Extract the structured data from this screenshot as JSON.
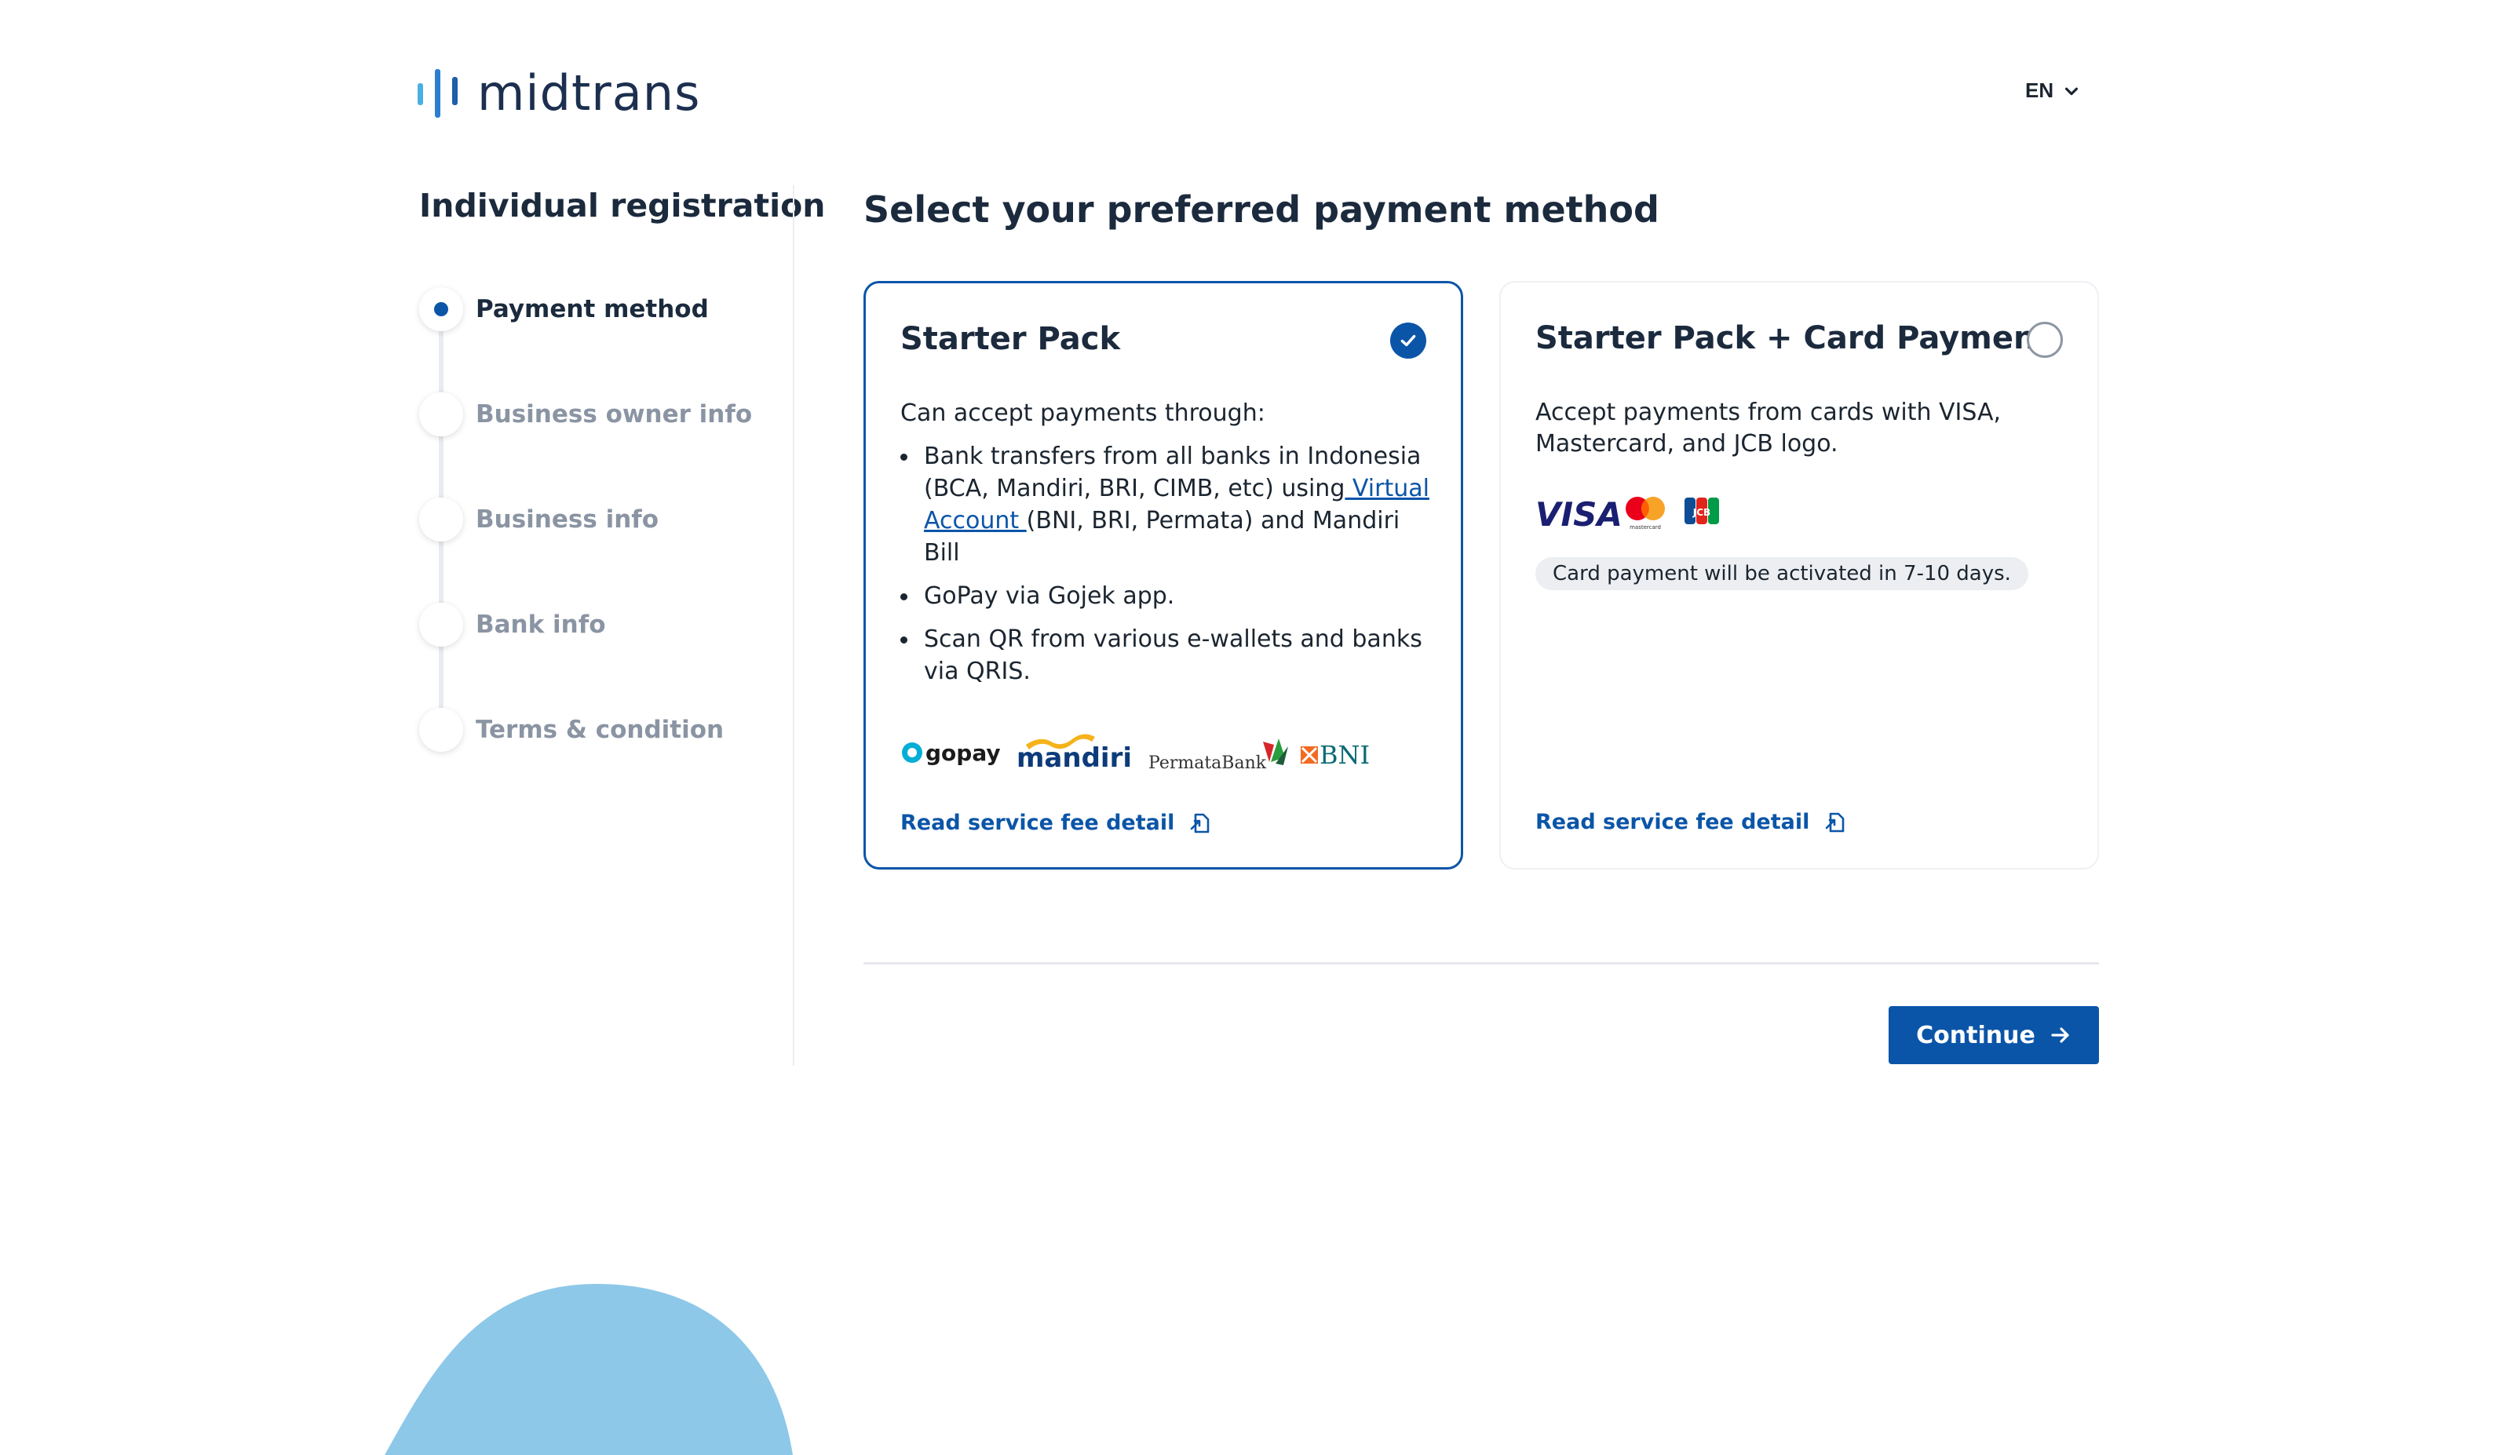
{
  "header": {
    "logo_text": "midtrans",
    "language": "EN"
  },
  "sidebar": {
    "title": "Individual registration",
    "steps": [
      {
        "label": "Payment method",
        "active": true
      },
      {
        "label": "Business owner info",
        "active": false
      },
      {
        "label": "Business info",
        "active": false
      },
      {
        "label": "Bank info",
        "active": false
      },
      {
        "label": "Terms & condition",
        "active": false
      }
    ]
  },
  "main": {
    "title": "Select your preferred payment method",
    "cards": [
      {
        "title": "Starter Pack",
        "selected": true,
        "intro": "Can accept payments through:",
        "bullets": {
          "b1_pre": "Bank transfers from all banks in Indonesia (BCA, Mandiri, BRI, CIMB, etc) using",
          "b1_link": " Virtual Account ",
          "b1_post": "(BNI, BRI, Permata) and Mandiri Bill",
          "b2": "GoPay via Gojek app.",
          "b3": "Scan QR from various e-wallets and banks via QRIS."
        },
        "partner_logos": {
          "gopay": "gopay",
          "mandiri": "mandiri",
          "permata": "PermataBank",
          "bni": "BNI"
        },
        "fee_link": "Read service fee detail"
      },
      {
        "title": "Starter Pack + Card Payment",
        "selected": false,
        "intro": "Accept payments from cards with VISA, Mastercard, and JCB logo.",
        "card_logos": {
          "visa": "VISA",
          "mastercard_caption": "mastercard",
          "jcb": "JCB"
        },
        "notice": "Card payment will be activated in 7-10 days.",
        "fee_link": "Read service fee detail"
      }
    ],
    "continue_label": "Continue"
  },
  "colors": {
    "primary": "#0b55a8",
    "heading": "#1b2a3d",
    "muted": "#8a94a3",
    "blob": "#8ec8e8",
    "logo_bar_light": "#4ab0e4",
    "logo_bar_dark": "#1f5ea8"
  }
}
